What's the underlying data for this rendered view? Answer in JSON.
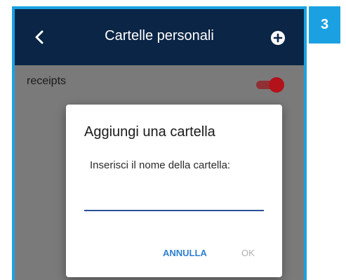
{
  "step_badge": "3",
  "appbar": {
    "title": "Cartelle personali",
    "back_icon": "chevron-left-icon",
    "add_icon": "plus-circle-icon"
  },
  "folders": [
    {
      "label": "receipts",
      "enabled": true
    }
  ],
  "dialog": {
    "title": "Aggiungi una cartella",
    "message": "Inserisci il nome della cartella:",
    "input_value": "",
    "cancel_label": "ANNULLA",
    "ok_label": "OK"
  },
  "colors": {
    "appbar_bg": "#0a2545",
    "accent_blue": "#1ba1e2",
    "toggle_on": "#b3121b",
    "cancel_text": "#2e7fd0",
    "ok_disabled": "#b0b0b0"
  }
}
